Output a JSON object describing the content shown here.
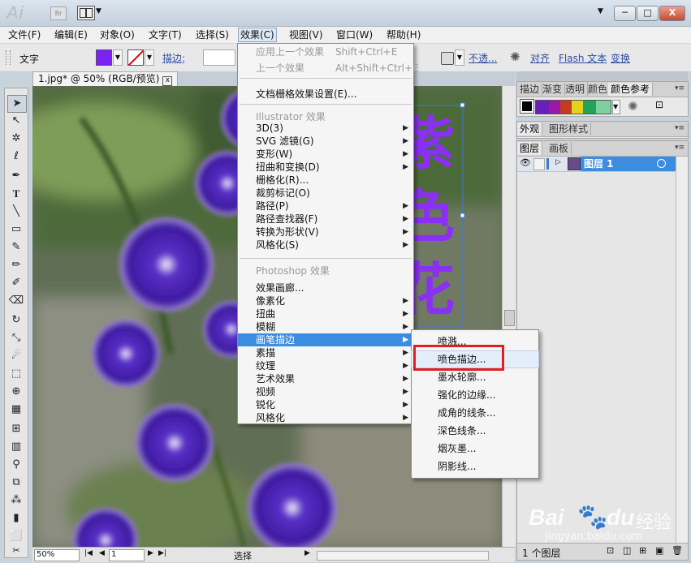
{
  "titlebar": {
    "logo": "Ai",
    "bridge": "Br",
    "window_buttons": [
      "─",
      "□",
      "X"
    ]
  },
  "menubar": [
    "文件(F)",
    "编辑(E)",
    "对象(O)",
    "文字(T)",
    "选择(S)",
    "效果(C)",
    "视图(V)",
    "窗口(W)",
    "帮助(H)"
  ],
  "control": {
    "label": "文字",
    "stroke_label": "描边:",
    "opacity_label": "不透...",
    "align_label": "对齐",
    "flash_label": "Flash 文本",
    "transform_label": "变换",
    "fill_color": "#7b22f3"
  },
  "doc_tab": {
    "title": "1.jpg* @ 50% (RGB/预览)",
    "close": "x"
  },
  "canvas_text": [
    "紫",
    "色",
    "花"
  ],
  "status": {
    "zoom": "50%",
    "page": "1",
    "mode": "选择"
  },
  "panels": {
    "color": {
      "tabs": [
        "描边",
        "渐变",
        "透明",
        "颜色",
        "颜色参考"
      ],
      "swatches": [
        "#000000",
        "#6a1fb8",
        "#9a19a6",
        "#c33c1e",
        "#e0d420",
        "#f0ea3a",
        "#22a35a",
        "#7ed0a0"
      ]
    },
    "appearance": {
      "tabs": [
        "外观",
        "图形样式"
      ]
    },
    "layers": {
      "tabs": [
        "图层",
        "画板"
      ],
      "layer_name": "图层 1",
      "footer": "1 个图层"
    }
  },
  "effect_menu": {
    "items": [
      {
        "label": "应用上一个效果",
        "shortcut": "Shift+Ctrl+E",
        "disabled": true
      },
      {
        "label": "上一个效果",
        "shortcut": "Alt+Shift+Ctrl+E",
        "disabled": true
      },
      {
        "label": "文档栅格效果设置(E)..."
      },
      {
        "label": "Illustrator 效果",
        "header": true
      },
      {
        "label": "3D(3)",
        "sub": true
      },
      {
        "label": "SVG 滤镜(G)",
        "sub": true
      },
      {
        "label": "变形(W)",
        "sub": true
      },
      {
        "label": "扭曲和变换(D)",
        "sub": true
      },
      {
        "label": "栅格化(R)..."
      },
      {
        "label": "裁剪标记(O)"
      },
      {
        "label": "路径(P)",
        "sub": true
      },
      {
        "label": "路径查找器(F)",
        "sub": true
      },
      {
        "label": "转换为形状(V)",
        "sub": true
      },
      {
        "label": "风格化(S)",
        "sub": true
      },
      {
        "label": "Photoshop 效果",
        "header": true
      },
      {
        "label": "效果画廊..."
      },
      {
        "label": "像素化",
        "sub": true
      },
      {
        "label": "扭曲",
        "sub": true
      },
      {
        "label": "模糊",
        "sub": true
      },
      {
        "label": "画笔描边",
        "sub": true,
        "highlighted": true
      },
      {
        "label": "素描",
        "sub": true
      },
      {
        "label": "纹理",
        "sub": true
      },
      {
        "label": "艺术效果",
        "sub": true
      },
      {
        "label": "视频",
        "sub": true
      },
      {
        "label": "锐化",
        "sub": true
      },
      {
        "label": "风格化",
        "sub": true
      }
    ]
  },
  "brush_submenu": {
    "items": [
      "喷溅...",
      "喷色描边...",
      "墨水轮廓...",
      "强化的边缘...",
      "成角的线条...",
      "深色线条...",
      "烟灰墨...",
      "阴影线..."
    ],
    "selected_index": 1,
    "annotation_color": "#e02020"
  },
  "watermark": {
    "brand": "Bai",
    "paw": "du",
    "cn": "经验",
    "url": "jingyan.baidu.com"
  }
}
